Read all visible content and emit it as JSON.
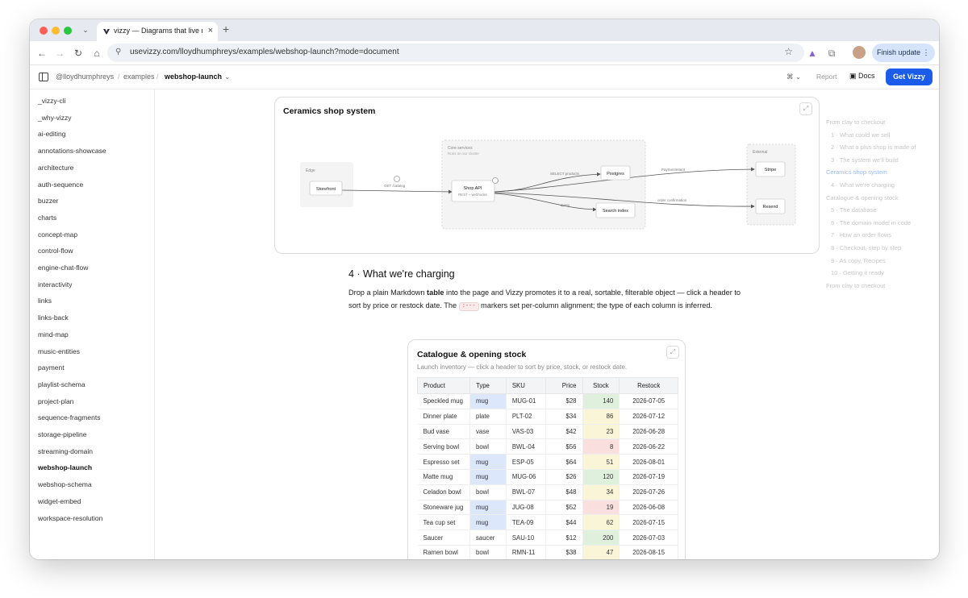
{
  "browser": {
    "tab_title": "vizzy — Diagrams that live next to your code",
    "url": "usevizzy.com/lloydhumphreys/examples/webshop-launch?mode=document",
    "finish_update": "Finish update",
    "window_colors": {
      "close": "#fe5f57",
      "minimize": "#febc2e",
      "zoom": "#28c840"
    }
  },
  "header": {
    "breadcrumb": [
      "@lloydhumphreys",
      "/",
      "examples",
      "/",
      "webshop-launch"
    ],
    "report": "Report",
    "docs": "Docs",
    "cta": "Get Vizzy",
    "accent": "#1b5dea"
  },
  "sidebar": {
    "items": [
      "_vizzy-cli",
      "_why-vizzy",
      "ai-editing",
      "annotations-showcase",
      "architecture",
      "auth-sequence",
      "buzzer",
      "charts",
      "concept-map",
      "control-flow",
      "engine-chat-flow",
      "interactivity",
      "links",
      "links-back",
      "mind-map",
      "music-entities",
      "payment",
      "playlist-schema",
      "project-plan",
      "sequence-fragments",
      "storage-pipeline",
      "streaming-domain",
      "webshop-launch",
      "webshop-schema",
      "widget-embed",
      "workspace-resolution"
    ],
    "active": "webshop-launch"
  },
  "diagram": {
    "title": "Ceramics shop system",
    "groups": {
      "edge": "Edge",
      "core": "Core services",
      "core_sub": "Runs on our cluster",
      "external": "External"
    },
    "nodes": {
      "storefront": "Storefront",
      "shop_api": "Shop API",
      "shop_api_sub": "REST + webhooks",
      "postgres": "Postgres",
      "search_index": "Search index",
      "stripe": "Stripe",
      "resend": "Resend"
    },
    "edges": {
      "get_catalog": "GET /catalog",
      "select_products": "SELECT products",
      "query": "query",
      "payment_intent": "PaymentIntent",
      "order_confirmation": "order confirmation"
    }
  },
  "section": {
    "heading": "4 · What we're charging",
    "p_a": "Drop a plain Markdown ",
    "p_bold": "table",
    "p_b": " into the page and Vizzy promotes it to a real, sortable, filterable object — click a header to sort by price or restock date. The ",
    "p_chip": ":---",
    "p_c": " markers set per-column alignment; the type of each column is inferred."
  },
  "table": {
    "title": "Catalogue & opening stock",
    "subtitle": "Launch inventory — click a header to sort by price, stock, or restock date.",
    "columns": [
      "Product",
      "Type",
      "SKU",
      "Price",
      "Stock",
      "Restock"
    ],
    "rows": [
      {
        "product": "Speckled mug",
        "type": "mug",
        "sku": "MUG-01",
        "price": "$28",
        "stock": "140",
        "restock": "2026-07-05"
      },
      {
        "product": "Dinner plate",
        "type": "plate",
        "sku": "PLT-02",
        "price": "$34",
        "stock": "86",
        "restock": "2026-07-12"
      },
      {
        "product": "Bud vase",
        "type": "vase",
        "sku": "VAS-03",
        "price": "$42",
        "stock": "23",
        "restock": "2026-06-28"
      },
      {
        "product": "Serving bowl",
        "type": "bowl",
        "sku": "BWL-04",
        "price": "$56",
        "stock": "8",
        "restock": "2026-06-22"
      },
      {
        "product": "Espresso set",
        "type": "mug",
        "sku": "ESP-05",
        "price": "$64",
        "stock": "51",
        "restock": "2026-08-01"
      },
      {
        "product": "Matte mug",
        "type": "mug",
        "sku": "MUG-06",
        "price": "$26",
        "stock": "120",
        "restock": "2026-07-19"
      },
      {
        "product": "Celadon bowl",
        "type": "bowl",
        "sku": "BWL-07",
        "price": "$48",
        "stock": "34",
        "restock": "2026-07-26"
      },
      {
        "product": "Stoneware jug",
        "type": "mug",
        "sku": "JUG-08",
        "price": "$52",
        "stock": "19",
        "restock": "2026-06-08"
      },
      {
        "product": "Tea cup set",
        "type": "mug",
        "sku": "TEA-09",
        "price": "$44",
        "stock": "62",
        "restock": "2026-07-15"
      },
      {
        "product": "Saucer",
        "type": "saucer",
        "sku": "SAU-10",
        "price": "$12",
        "stock": "200",
        "restock": "2026-07-03"
      },
      {
        "product": "Ramen bowl",
        "type": "bowl",
        "sku": "RMN-11",
        "price": "$38",
        "stock": "47",
        "restock": "2026-08-15"
      }
    ],
    "type_colors": {
      "mug": "#dde7fb"
    },
    "stock_colors": {
      "high": "#dff0dc",
      "medium": "#fbf5d8",
      "low": "#f9e0df"
    }
  },
  "toc": {
    "items": [
      {
        "label": "From clay to checkout",
        "level": 0,
        "active": false
      },
      {
        "label": "1 · What could we sell",
        "level": 1,
        "active": false
      },
      {
        "label": "2 · What a plus shop is made of",
        "level": 1,
        "active": false
      },
      {
        "label": "3 · The system we'll build",
        "level": 1,
        "active": false
      },
      {
        "label": "Ceramics shop system",
        "level": 0,
        "active": true
      },
      {
        "label": "4 · What we're charging",
        "level": 1,
        "active": false
      },
      {
        "label": "Catalogue & opening stock",
        "level": 0,
        "active": false
      },
      {
        "label": "5 · The database",
        "level": 1,
        "active": false
      },
      {
        "label": "6 · The domain model in code",
        "level": 1,
        "active": false
      },
      {
        "label": "7 · How an order flows",
        "level": 1,
        "active": false
      },
      {
        "label": "8 · Checkout, step by step",
        "level": 1,
        "active": false
      },
      {
        "label": "9 · As copy, Recipes",
        "level": 1,
        "active": false
      },
      {
        "label": "10 · Getting it ready",
        "level": 1,
        "active": false
      },
      {
        "label": "From clay to checkout",
        "level": 0,
        "active": false
      }
    ]
  }
}
